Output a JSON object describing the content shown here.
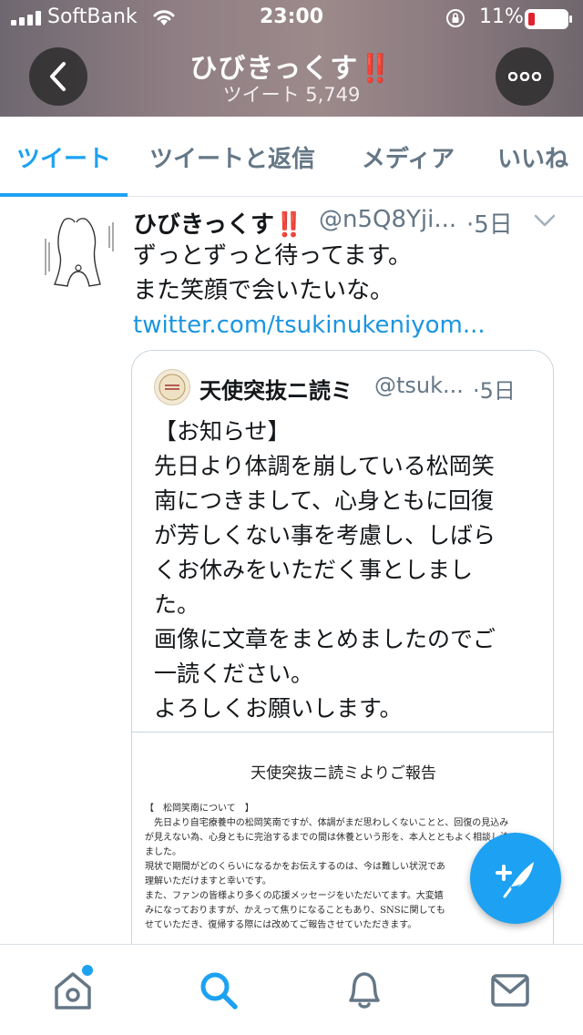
{
  "status_bar": {
    "carrier": "SoftBank",
    "time": "23:00",
    "battery": "11%"
  },
  "profile": {
    "name": "ひびきっくす",
    "name_emoji": "‼️",
    "tweet_count": "ツイート 5,749"
  },
  "tabs": [
    {
      "label": "ツイート",
      "active": true
    },
    {
      "label": "ツイートと返信",
      "active": false
    },
    {
      "label": "メディア",
      "active": false
    },
    {
      "label": "いいね",
      "active": false
    }
  ],
  "tweet": {
    "author_name": "ひびきっくす",
    "author_emoji": "‼️",
    "handle": "@n5Q8Yji...",
    "time": "·5日",
    "lines": [
      "ずっとずっと待ってます。",
      "また笑顔で会いたいな。"
    ],
    "link": "twitter.com/tsukinukeniyom..."
  },
  "quote": {
    "name": "天使突抜ニ読ミ",
    "handle": "@tsuk...",
    "time": "·5日",
    "lines": [
      "【お知らせ】",
      "先日より体調を崩している松岡笑",
      "南につきまして、心身ともに回復",
      "が芳しくない事を考慮し、しばら",
      "くお休みをいただく事としまし",
      "た。",
      "画像に文章をまとめましたのでご",
      "一読ください。",
      "よろしくお願いします。"
    ],
    "image": {
      "title": "天使突抜ニ読ミよりご報告",
      "lines": [
        "【　松岡笑南について　】",
        "　先日より自宅療養中の松岡笑南ですが、体調がまだ思わしくないことと、回復の見込み",
        "が見えない為、心身ともに完治するまでの間は休養という形を、本人とともよく相談し決め",
        "ました。",
        "現状で期間がどのくらいになるかをお伝えするのは、今は難しい状況であ",
        "理解いただけますと幸いです。",
        "また、ファンの皆様より多くの応援メッセージをいただいてます。大変嬉",
        "みになっておりますが、かえって焦りになることもあり、SNSに関しても",
        "せていただき、復帰する際には改めてご報告させていただきます。"
      ]
    }
  },
  "colors": {
    "accent": "#1da1f2",
    "link": "#1b95e0",
    "secondary_text": "#657786",
    "emoji_red": "#e0222e"
  },
  "icons": {
    "nav": [
      "home-icon",
      "search-icon",
      "notifications-icon",
      "messages-icon"
    ],
    "compose": "compose-tweet-icon"
  }
}
